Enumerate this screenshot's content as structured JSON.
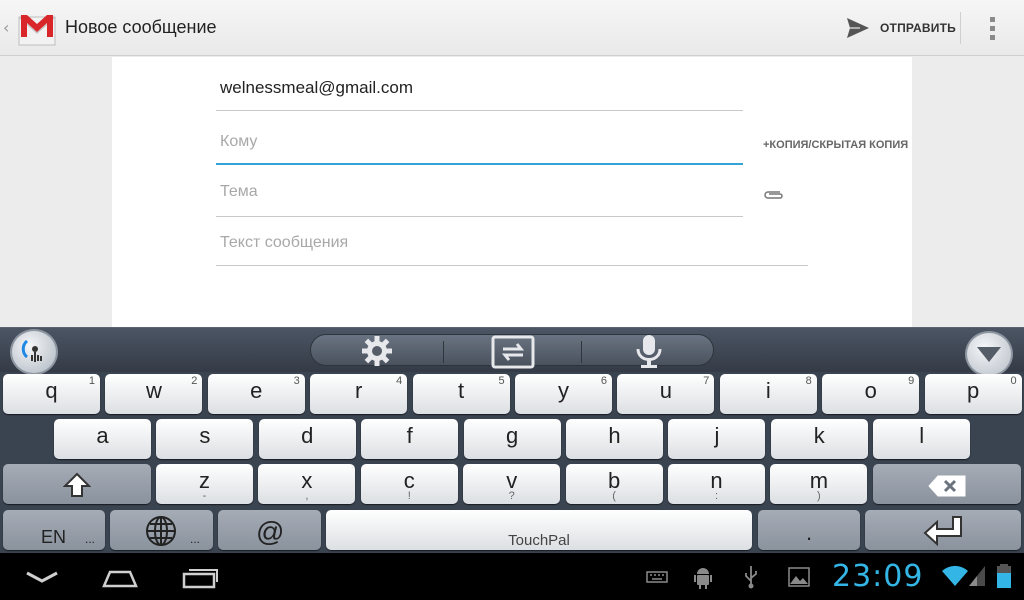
{
  "actionbar": {
    "title": "Новое сообщение",
    "send_label": "ОТПРАВИТЬ",
    "up_caret": "‹"
  },
  "compose": {
    "from": "welnessmeal@gmail.com",
    "to_placeholder": "Кому",
    "cc_bcc_label": "+КОПИЯ/СКРЫТАЯ КОПИЯ",
    "subject_placeholder": "Тема",
    "body_placeholder": "Текст сообщения"
  },
  "keyboard": {
    "row1": [
      {
        "k": "q",
        "n": "1"
      },
      {
        "k": "w",
        "n": "2"
      },
      {
        "k": "e",
        "n": "3"
      },
      {
        "k": "r",
        "n": "4"
      },
      {
        "k": "t",
        "n": "5"
      },
      {
        "k": "y",
        "n": "6"
      },
      {
        "k": "u",
        "n": "7"
      },
      {
        "k": "i",
        "n": "8"
      },
      {
        "k": "o",
        "n": "9"
      },
      {
        "k": "p",
        "n": "0"
      }
    ],
    "row2": [
      "a",
      "s",
      "d",
      "f",
      "g",
      "h",
      "j",
      "k",
      "l"
    ],
    "row3": [
      {
        "k": "z",
        "s": "-"
      },
      {
        "k": "x",
        "s": ","
      },
      {
        "k": "c",
        "s": "!"
      },
      {
        "k": "v",
        "s": "?"
      },
      {
        "k": "b",
        "s": "("
      },
      {
        "k": "n",
        "s": ":"
      },
      {
        "k": "m",
        "s": ")"
      }
    ],
    "lang_label": "EN",
    "more_dots": "...",
    "at_label": "@",
    "space_label": "TouchPal",
    "period_label": "."
  },
  "statusbar": {
    "clock": "23:09"
  },
  "colors": {
    "accent": "#33b5e5",
    "focus_underline": "#33a4d8",
    "keyboard_bg": "#3a4350"
  },
  "icons": {
    "app": "gmail-icon",
    "send": "send-icon",
    "overflow": "overflow-menu-icon",
    "attach": "paperclip-icon",
    "settings": "gear-icon",
    "switch": "switch-layout-icon",
    "voice": "microphone-icon",
    "hide": "hide-keyboard-icon",
    "shift": "shift-icon",
    "backspace": "backspace-icon",
    "enter": "enter-icon",
    "globe": "globe-icon"
  }
}
